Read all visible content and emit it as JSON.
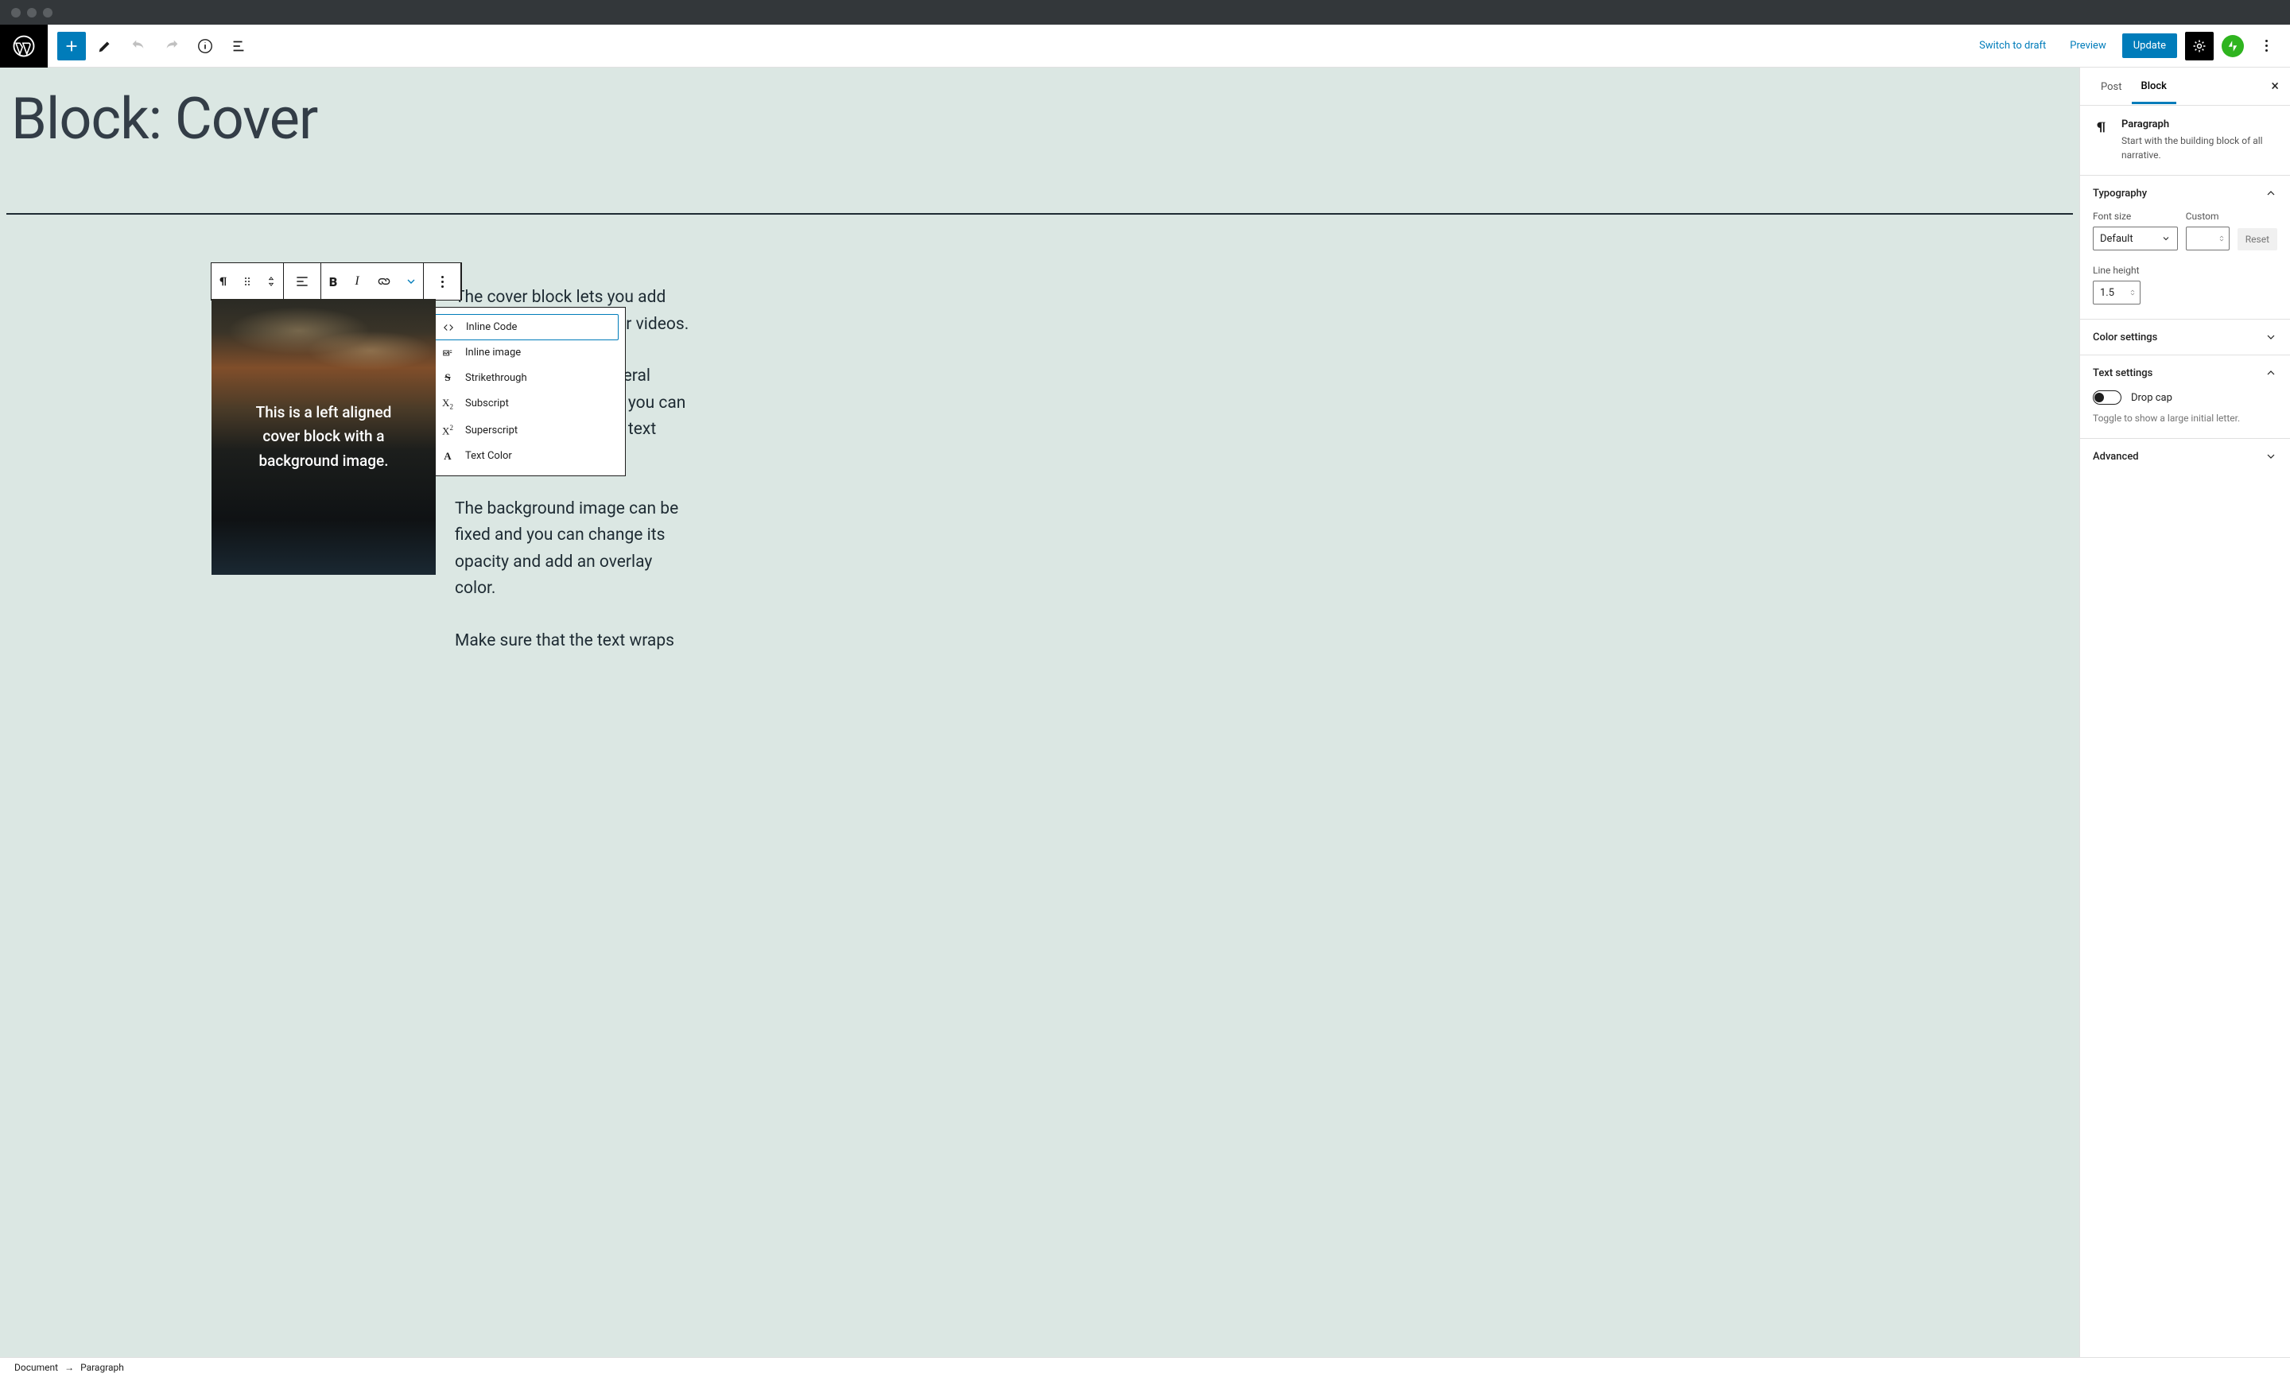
{
  "header": {
    "switch_draft": "Switch to draft",
    "preview": "Preview",
    "update": "Update"
  },
  "page": {
    "title": "Block: Cover"
  },
  "content": {
    "p1": "The cover block lets you add text on top of images or videos.",
    "p2": "This blocktype has several alignment options, and you can also align or center the text inside the block.",
    "p3": "The background image can be fixed and you can change its opacity and add an overlay color.",
    "p4": "Make sure that the text wraps"
  },
  "cover": {
    "text_l1": "This is a left aligned",
    "text_l2": "cover block with a",
    "text_l3": "background image."
  },
  "dropdown": {
    "inline_code": "Inline Code",
    "inline_image": "Inline image",
    "strike": "Strikethrough",
    "sub": "Subscript",
    "sup": "Superscript",
    "text_color": "Text Color"
  },
  "sidebar": {
    "tab_post": "Post",
    "tab_block": "Block",
    "block_name": "Paragraph",
    "block_desc": "Start with the building block of all narrative.",
    "typography": {
      "title": "Typography",
      "font_label": "Font size",
      "custom_label": "Custom",
      "default": "Default",
      "reset": "Reset",
      "line_height_label": "Line height",
      "line_height_value": "1.5"
    },
    "color": {
      "title": "Color settings"
    },
    "text_settings": {
      "title": "Text settings",
      "drop_cap": "Drop cap",
      "help": "Toggle to show a large initial letter."
    },
    "advanced": {
      "title": "Advanced"
    }
  },
  "footer": {
    "document": "Document",
    "paragraph": "Paragraph"
  }
}
